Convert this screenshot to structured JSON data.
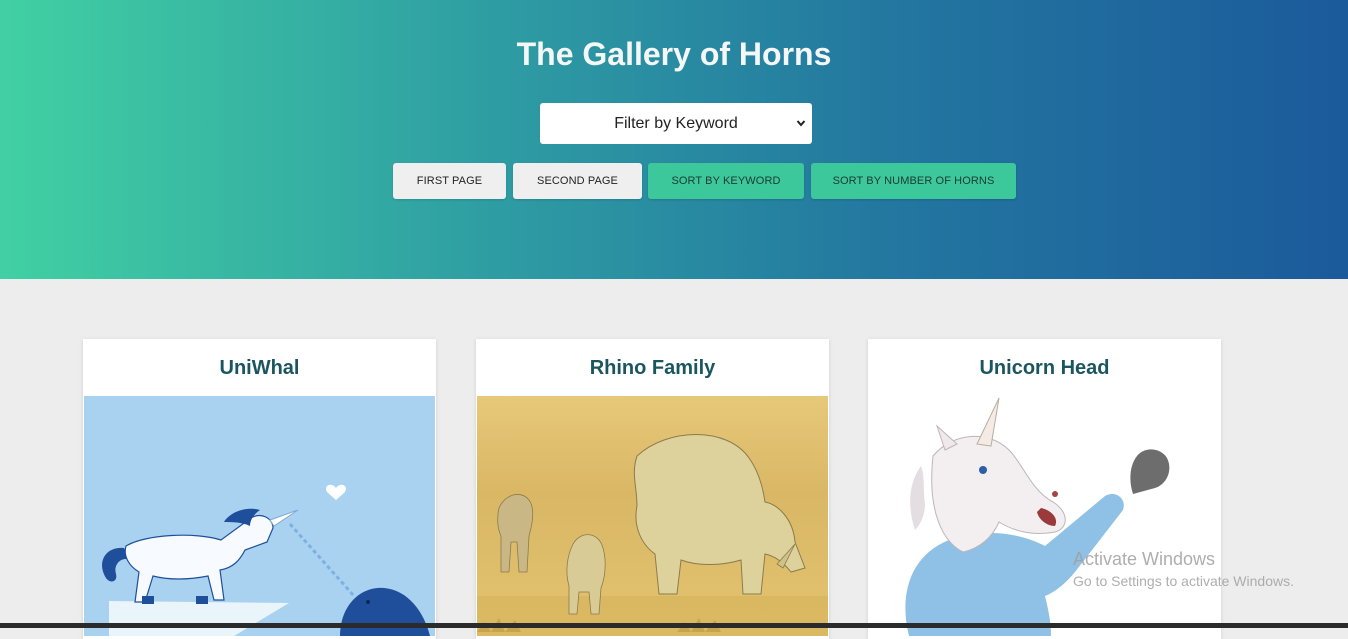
{
  "header": {
    "title": "The Gallery of Horns",
    "filter": {
      "selected": "Filter by Keyword"
    },
    "buttons": {
      "first_page": "First Page",
      "second_page": "Second Page",
      "sort_keyword": "Sort by Keyword",
      "sort_horns": "Sort by Number of Horns"
    }
  },
  "cards": [
    {
      "title": "UniWhal"
    },
    {
      "title": "Rhino Family"
    },
    {
      "title": "Unicorn Head"
    }
  ],
  "watermark": {
    "line1": "Activate Windows",
    "line2": "Go to Settings to activate Windows."
  },
  "colors": {
    "gradient_start": "#41d0a3",
    "gradient_end": "#1b5a9b",
    "accent_button": "#3cc89a",
    "card_title": "#1b5660"
  }
}
